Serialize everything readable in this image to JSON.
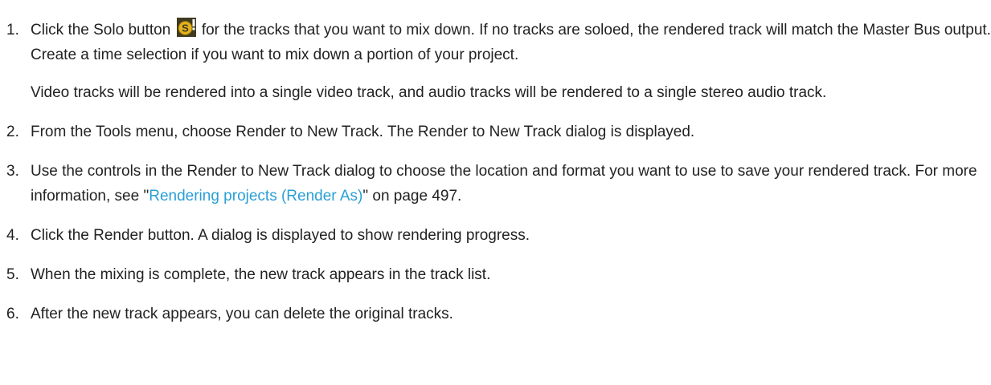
{
  "steps": [
    {
      "number": "1.",
      "before_icon": "Click the Solo button",
      "icon": "solo-button-icon",
      "icon_letter": "S",
      "after_icon": "for the tracks that you want to mix down. If no tracks are soloed, the rendered track will match the Master Bus output. Create a time selection if you want to mix down a portion of your project.",
      "note": "Video tracks will be rendered into a single video track, and audio tracks will be rendered to a single stereo audio track."
    },
    {
      "number": "2.",
      "text": "From the Tools menu, choose Render to New Track. The Render to New Track dialog is displayed."
    },
    {
      "number": "3.",
      "before_link": "Use the controls in the Render to New Track dialog to choose the location and format you want to use to save your rendered track. For more information, see \"",
      "link": "Rendering projects (Render As)",
      "after_link": "\" on page 497."
    },
    {
      "number": "4.",
      "text": "Click the Render button. A dialog is displayed to show rendering progress."
    },
    {
      "number": "5.",
      "text": "When the mixing is complete, the new track appears in the track list."
    },
    {
      "number": "6.",
      "text": "After the new track appears, you can delete the original tracks."
    }
  ],
  "colors": {
    "link": "#2a9fd6",
    "icon_background": "#3f3a20",
    "icon_circle": "#e3b21c",
    "icon_exclaim": "#ffffff"
  }
}
